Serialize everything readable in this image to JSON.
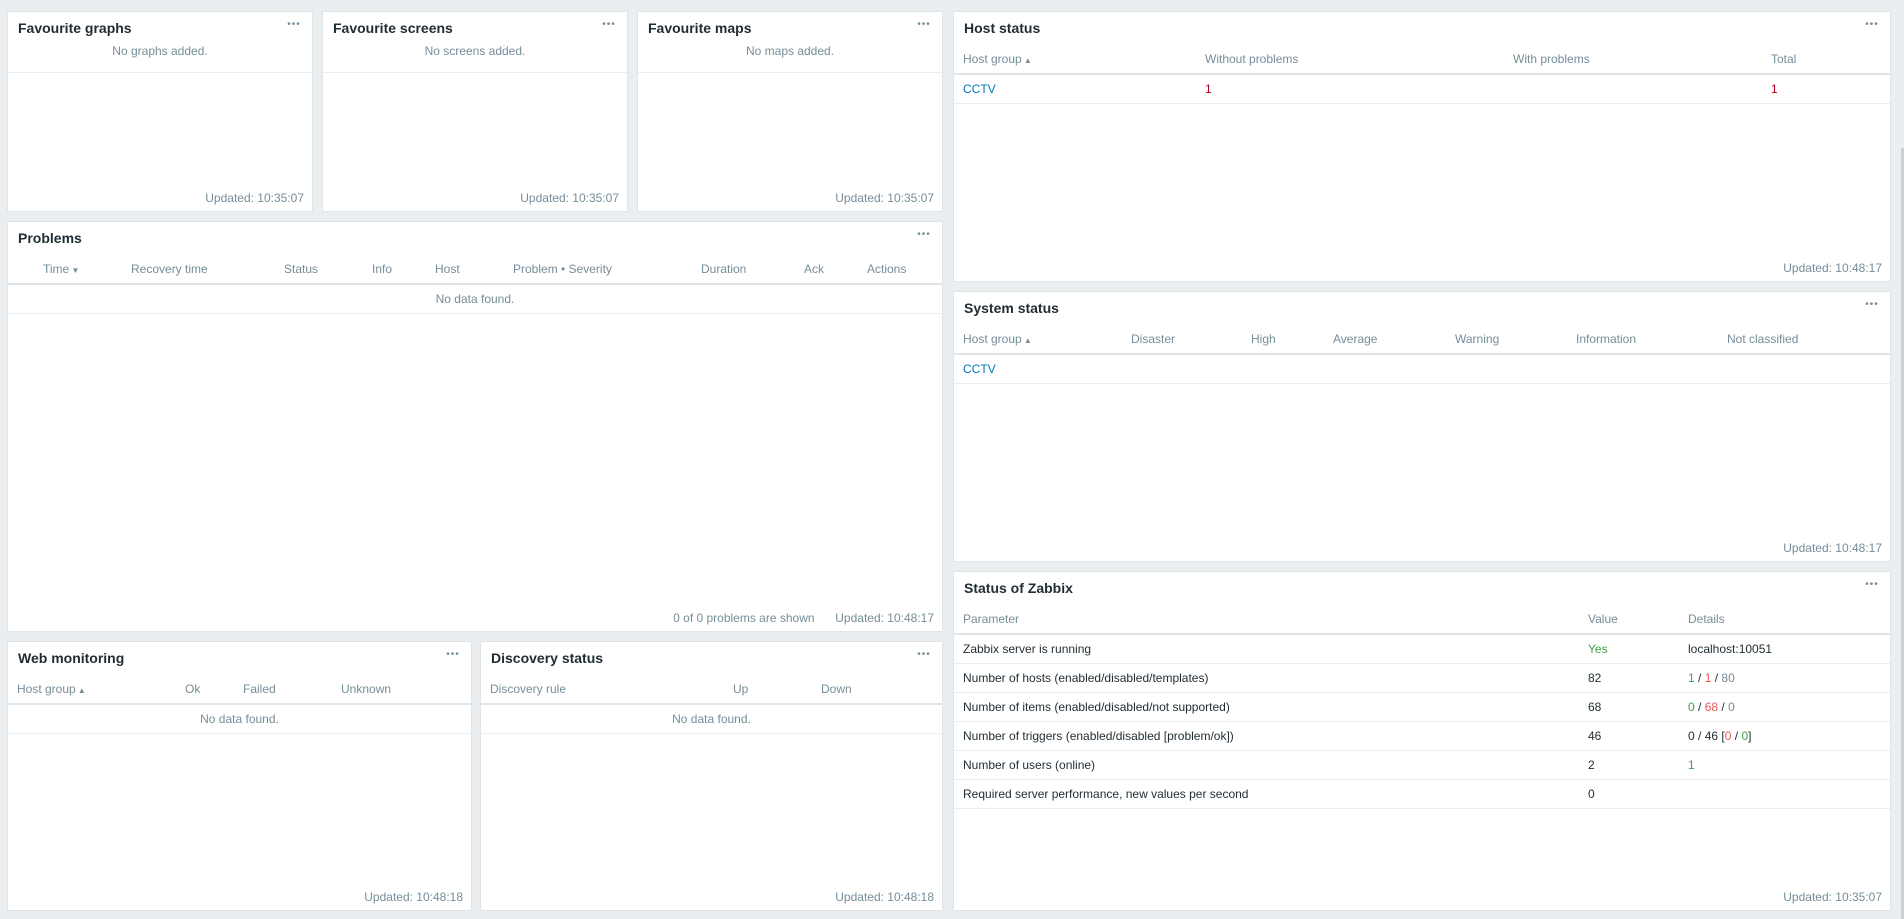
{
  "fav_graphs": {
    "title": "Favourite graphs",
    "empty": "No graphs added.",
    "updated": "Updated: 10:35:07"
  },
  "fav_screens": {
    "title": "Favourite screens",
    "empty": "No screens added.",
    "updated": "Updated: 10:35:07"
  },
  "fav_maps": {
    "title": "Favourite maps",
    "empty": "No maps added.",
    "updated": "Updated: 10:35:07"
  },
  "problems": {
    "title": "Problems",
    "columns": [
      "Time",
      "Recovery time",
      "Status",
      "Info",
      "Host",
      "Problem • Severity",
      "Duration",
      "Ack",
      "Actions"
    ],
    "empty": "No data found.",
    "shown": "0 of 0 problems are shown",
    "updated": "Updated: 10:48:17"
  },
  "web_monitoring": {
    "title": "Web monitoring",
    "columns": [
      "Host group",
      "Ok",
      "Failed",
      "Unknown"
    ],
    "empty": "No data found.",
    "updated": "Updated: 10:48:18"
  },
  "discovery": {
    "title": "Discovery status",
    "columns": [
      "Discovery rule",
      "Up",
      "Down"
    ],
    "empty": "No data found.",
    "updated": "Updated: 10:48:18"
  },
  "host_status": {
    "title": "Host status",
    "columns": [
      "Host group",
      "Without problems",
      "With problems",
      "Total"
    ],
    "rows": [
      {
        "group": "CCTV",
        "without": "1",
        "with": "",
        "total": "1"
      }
    ],
    "updated": "Updated: 10:48:17"
  },
  "system_status": {
    "title": "System status",
    "columns": [
      "Host group",
      "Disaster",
      "High",
      "Average",
      "Warning",
      "Information",
      "Not classified"
    ],
    "rows": [
      {
        "group": "CCTV"
      }
    ],
    "updated": "Updated: 10:48:17"
  },
  "zabbix_status": {
    "title": "Status of Zabbix",
    "columns": [
      "Parameter",
      "Value",
      "Details"
    ],
    "rows": [
      {
        "param": "Zabbix server is running",
        "value": "Yes",
        "details": "localhost:10051"
      },
      {
        "param": "Number of hosts (enabled/disabled/templates)",
        "value": "82",
        "d1": "1",
        "d2": "1",
        "d3": "80"
      },
      {
        "param": "Number of items (enabled/disabled/not supported)",
        "value": "68",
        "d1": "0",
        "d2": "68",
        "d3": "0"
      },
      {
        "param": "Number of triggers (enabled/disabled [problem/ok])",
        "value": "46",
        "d1": "0",
        "d2": "46",
        "d3": "0",
        "d4": "0"
      },
      {
        "param": "Number of users (online)",
        "value": "2",
        "d1": "1"
      },
      {
        "param": "Required server performance, new values per second",
        "value": "0"
      }
    ],
    "updated": "Updated: 10:35:07"
  }
}
